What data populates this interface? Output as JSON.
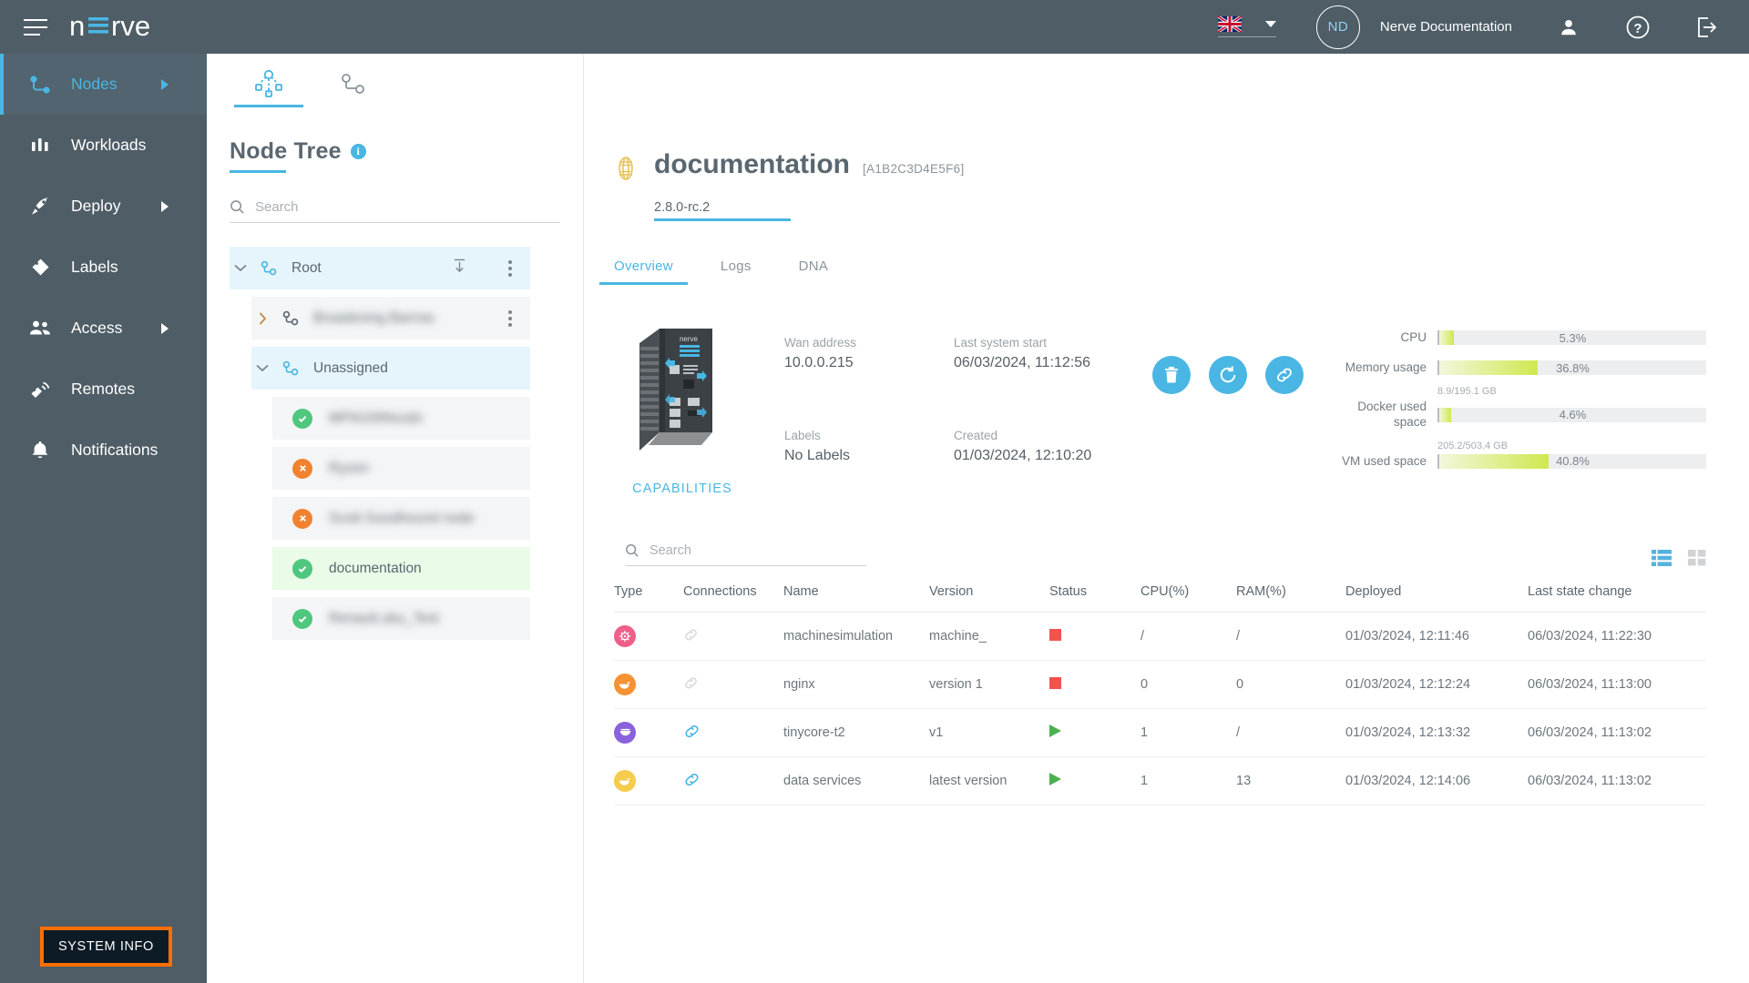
{
  "topbar": {
    "menu_icon": "hamburger-menu-icon",
    "logo_text": "nerve",
    "language": {
      "selected": "en",
      "flag": "uk-flag-icon"
    },
    "avatar_initials": "ND",
    "org_name": "Nerve Documentation",
    "icons": [
      "user-icon",
      "help-icon",
      "logout-icon"
    ]
  },
  "sidebar": {
    "items": [
      {
        "label": "Nodes",
        "icon": "nodes-icon",
        "active": true,
        "expandable": true
      },
      {
        "label": "Workloads",
        "icon": "workloads-icon",
        "active": false,
        "expandable": false
      },
      {
        "label": "Deploy",
        "icon": "deploy-rocket-icon",
        "active": false,
        "expandable": true
      },
      {
        "label": "Labels",
        "icon": "labels-tag-icon",
        "active": false,
        "expandable": false
      },
      {
        "label": "Access",
        "icon": "access-users-icon",
        "active": false,
        "expandable": true
      },
      {
        "label": "Remotes",
        "icon": "remotes-icon",
        "active": false,
        "expandable": false
      },
      {
        "label": "Notifications",
        "icon": "notifications-bell-icon",
        "active": false,
        "expandable": false
      }
    ],
    "system_info_label": "SYSTEM INFO"
  },
  "tree_panel": {
    "tabs": [
      {
        "icon": "node-tree-icon",
        "active": true
      },
      {
        "icon": "node-list-icon",
        "active": false
      }
    ],
    "title": "Node Tree",
    "info_badge": "i",
    "search_placeholder": "Search",
    "search_value": "",
    "rows": [
      {
        "label": "Root",
        "level": 0,
        "expanded": true,
        "selected": true,
        "kebab": true,
        "download": true,
        "redacted": false
      },
      {
        "label": "Broadening Barrow",
        "level": 1,
        "expanded": false,
        "selected": false,
        "kebab": true,
        "download": false,
        "redacted": true
      },
      {
        "label": "Unassigned",
        "level": 1,
        "expanded": true,
        "selected": true,
        "kebab": false,
        "download": false,
        "redacted": false
      },
      {
        "label": "MFN100Nxxdn",
        "level": 2,
        "status": "ok",
        "active": false,
        "redacted": true
      },
      {
        "label": "Ryzen",
        "level": 2,
        "status": "err",
        "active": false,
        "redacted": true
      },
      {
        "label": "Scott Goodhound node",
        "level": 2,
        "status": "err",
        "active": false,
        "redacted": true
      },
      {
        "label": "documentation",
        "level": 2,
        "status": "ok",
        "active": true,
        "redacted": false
      },
      {
        "label": "Renault.ubu_Test",
        "level": 2,
        "status": "ok",
        "active": false,
        "redacted": true
      }
    ]
  },
  "node": {
    "icon": "dna-icon",
    "name": "documentation",
    "serial": "[A1B2C3D4E5F6]",
    "version": "2.8.0-rc.2",
    "tabs": [
      {
        "label": "Overview",
        "active": true
      },
      {
        "label": "Logs",
        "active": false
      },
      {
        "label": "DNA",
        "active": false
      }
    ],
    "device_image_alt": "nerve-industrial-pc",
    "capabilities_label": "CAPABILITIES",
    "info": [
      {
        "label": "Wan address",
        "value": "10.0.0.215"
      },
      {
        "label": "Last system start",
        "value": "06/03/2024, 11:12:56"
      },
      {
        "label": "Labels",
        "value": "No Labels"
      },
      {
        "label": "Created",
        "value": "01/03/2024, 12:10:20"
      }
    ],
    "actions": [
      {
        "name": "delete-node-button",
        "icon": "trash-icon"
      },
      {
        "name": "reboot-node-button",
        "icon": "reboot-icon"
      },
      {
        "name": "node-connections-button",
        "icon": "link-icon"
      }
    ],
    "metrics": [
      {
        "label": "CPU",
        "percent": "5.3%",
        "value": 5.3,
        "caption": ""
      },
      {
        "label": "Memory usage",
        "percent": "36.8%",
        "value": 36.8,
        "caption": ""
      },
      {
        "label": "Docker used space",
        "percent": "4.6%",
        "value": 4.6,
        "caption": "8.9/195.1 GB"
      },
      {
        "label": "VM used space",
        "percent": "40.8%",
        "value": 40.8,
        "caption": "205.2/503.4 GB"
      }
    ]
  },
  "workloads": {
    "search_placeholder": "Search",
    "search_value": "",
    "view_modes": [
      {
        "name": "list-view-toggle",
        "active": true
      },
      {
        "name": "grid-view-toggle",
        "active": false
      }
    ],
    "columns": [
      "Type",
      "Connections",
      "Name",
      "Version",
      "Status",
      "CPU(%)",
      "RAM(%)",
      "Deployed",
      "Last state change"
    ],
    "rows": [
      {
        "type_icon": "codesys-icon",
        "type_color": "#ef5f8a",
        "connection": "chain-icon",
        "connection_active": false,
        "name": "machinesimulation",
        "version": "machine_",
        "status": "stopped",
        "cpu": "/",
        "ram": "/",
        "deployed": "01/03/2024, 12:11:46",
        "last_state_change": "06/03/2024, 11:22:30"
      },
      {
        "type_icon": "docker-icon",
        "type_color": "#f59233",
        "connection": "chain-icon",
        "connection_active": false,
        "name": "nginx",
        "version": "version 1",
        "status": "stopped",
        "cpu": "0",
        "ram": "0",
        "deployed": "01/03/2024, 12:12:24",
        "last_state_change": "06/03/2024, 11:13:00"
      },
      {
        "type_icon": "vm-icon",
        "type_color": "#8b62dd",
        "connection": "chain-icon",
        "connection_active": true,
        "name": "tinycore-t2",
        "version": "v1",
        "status": "running",
        "cpu": "1",
        "ram": "/",
        "deployed": "01/03/2024, 12:13:32",
        "last_state_change": "06/03/2024, 11:13:02"
      },
      {
        "type_icon": "docker-compose-icon",
        "type_color": "#f5c council",
        "connection": "chain-icon",
        "connection_active": true,
        "name": "data services",
        "version": "latest version",
        "status": "running",
        "cpu": "1",
        "ram": "13",
        "deployed": "01/03/2024, 12:14:06",
        "last_state_change": "06/03/2024, 11:13:02"
      }
    ]
  },
  "colors": {
    "brand_blue": "#49b6e3",
    "nav_bg": "#4e5d66",
    "ok_green": "#4fc77e",
    "error_orange": "#f2822f",
    "status_stopped": "#f4524d",
    "status_running": "#4caf50",
    "bar_green": "#cfe84f",
    "highlight_orange": "#ff6f00"
  }
}
